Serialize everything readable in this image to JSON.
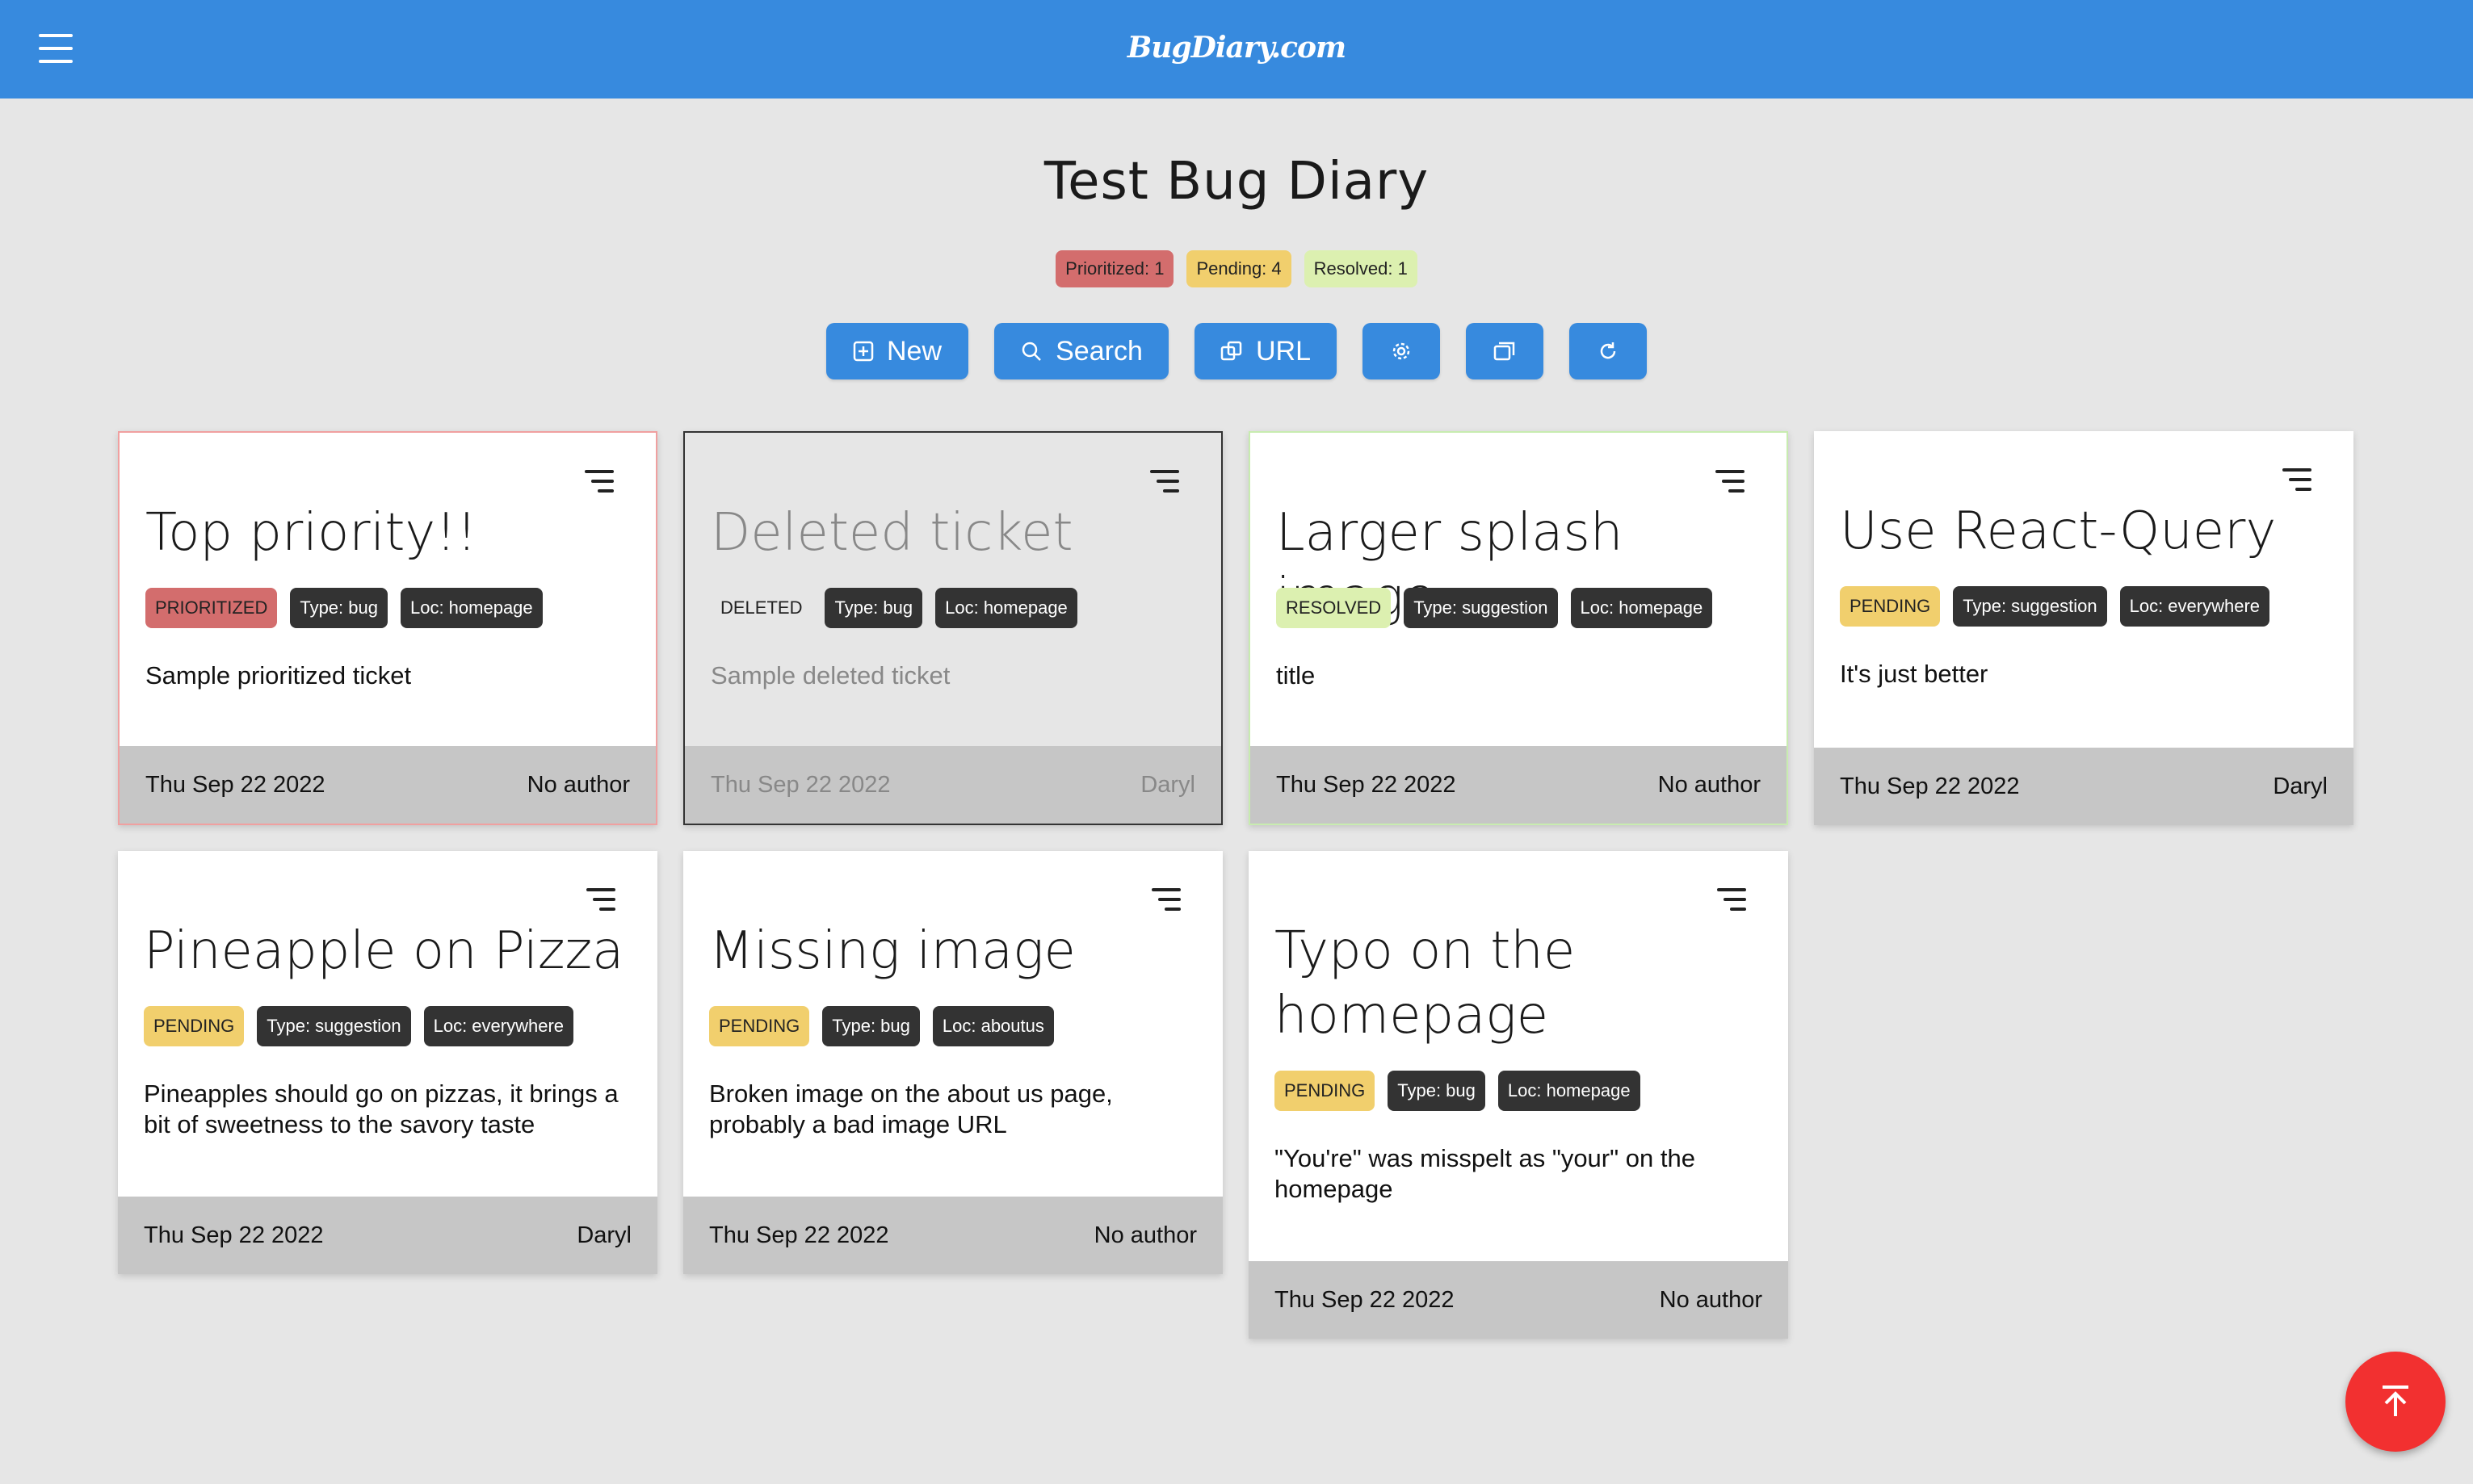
{
  "header": {
    "logo": "BugDiary.com"
  },
  "page": {
    "title": "Test Bug Diary"
  },
  "counts": [
    {
      "label": "Prioritized: 1",
      "color": "#d36d6d"
    },
    {
      "label": "Pending: 4",
      "color": "#f1cf6d"
    },
    {
      "label": "Resolved: 1",
      "color": "#dcf0b0"
    }
  ],
  "toolbar": {
    "new_label": "New",
    "search_label": "Search",
    "url_label": "URL",
    "icons": [
      "plus-square-icon",
      "search-icon",
      "copy-icon",
      "gear-icon",
      "window-icon",
      "refresh-icon"
    ]
  },
  "status_colors": {
    "PRIORITIZED": "#d36d6d",
    "PENDING": "#f1cf6d",
    "RESOLVED": "#dcf0b0",
    "DELETED": "transparent"
  },
  "cards": [
    {
      "title": "Top priority!!",
      "status": "PRIORITIZED",
      "type": "Type: bug",
      "loc": "Loc: homepage",
      "description": "Sample prioritized ticket",
      "date": "Thu Sep 22 2022",
      "author": "No author"
    },
    {
      "title": "Deleted ticket",
      "status": "DELETED",
      "type": "Type: bug",
      "loc": "Loc: homepage",
      "description": "Sample deleted ticket",
      "date": "Thu Sep 22 2022",
      "author": "Daryl"
    },
    {
      "title": "Larger splash image",
      "status": "RESOLVED",
      "type": "Type: suggestion",
      "loc": "Loc: homepage",
      "description": "title",
      "date": "Thu Sep 22 2022",
      "author": "No author"
    },
    {
      "title": "Use React-Query",
      "status": "PENDING",
      "type": "Type: suggestion",
      "loc": "Loc: everywhere",
      "description": "It's just better",
      "date": "Thu Sep 22 2022",
      "author": "Daryl"
    },
    {
      "title": "Pineapple on Pizza",
      "status": "PENDING",
      "type": "Type: suggestion",
      "loc": "Loc: everywhere",
      "description": "Pineapples should go on pizzas, it brings a bit of sweetness to the savory taste",
      "date": "Thu Sep 22 2022",
      "author": "Daryl"
    },
    {
      "title": "Missing image",
      "status": "PENDING",
      "type": "Type: bug",
      "loc": "Loc: aboutus",
      "description": "Broken image on the about us page, probably a bad image URL",
      "date": "Thu Sep 22 2022",
      "author": "No author"
    },
    {
      "title": "Typo on the homepage",
      "status": "PENDING",
      "type": "Type: bug",
      "loc": "Loc: homepage",
      "description": "\"You're\" was misspelt as \"your\" on the homepage",
      "date": "Thu Sep 22 2022",
      "author": "No author"
    }
  ]
}
